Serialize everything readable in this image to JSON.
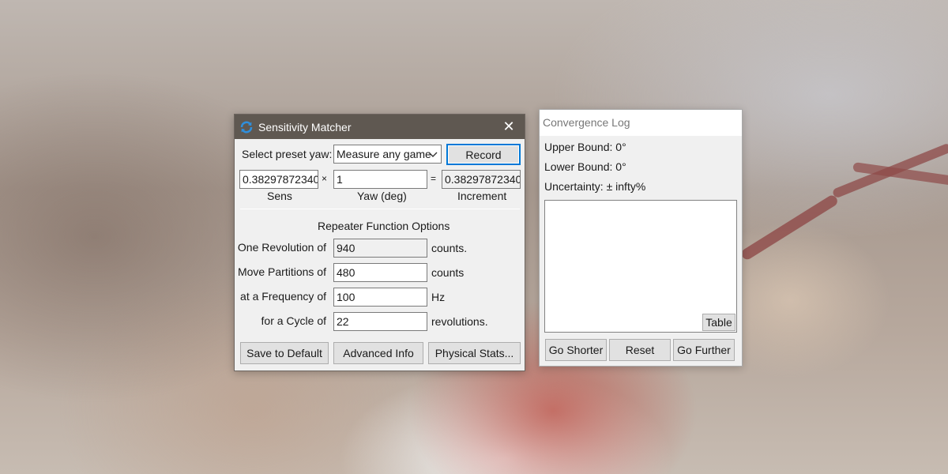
{
  "main_window": {
    "title": "Sensitivity Matcher",
    "close_glyph": "✕",
    "preset_label": "Select preset yaw:",
    "preset_value": "Measure any game",
    "record_label": "Record",
    "sens_value": "0.38297872340",
    "times_symbol": "×",
    "yaw_value": "1",
    "equals_symbol": "=",
    "increment_value": "0.38297872340",
    "sens_caption": "Sens",
    "yaw_caption": "Yaw (deg)",
    "increment_caption": "Increment",
    "repeater_header": "Repeater Function Options",
    "rows": [
      {
        "label": "One Revolution of",
        "value": "940",
        "unit": "counts."
      },
      {
        "label": "Move Partitions of",
        "value": "480",
        "unit": "counts"
      },
      {
        "label": "at a Frequency of",
        "value": "100",
        "unit": "Hz"
      },
      {
        "label": "for a Cycle of",
        "value": "22",
        "unit": "revolutions."
      }
    ],
    "buttons": {
      "save_default": "Save to Default",
      "advanced_info": "Advanced Info",
      "physical_stats": "Physical Stats..."
    }
  },
  "log_window": {
    "title": "Convergence Log",
    "upper_bound": "Upper Bound: 0°",
    "lower_bound": "Lower Bound: 0°",
    "uncertainty": "Uncertainty: ± infty%",
    "table_label": "Table",
    "buttons": {
      "go_shorter": "Go Shorter",
      "reset": "Reset",
      "go_further": "Go Further"
    }
  },
  "icons": {
    "app_icon": "refresh-icon",
    "close": "close-icon",
    "dropdown": "chevron-down-icon"
  },
  "colors": {
    "titlebar": "#5f5851",
    "accent": "#0078d7",
    "app_icon": "#2f8fdc"
  }
}
